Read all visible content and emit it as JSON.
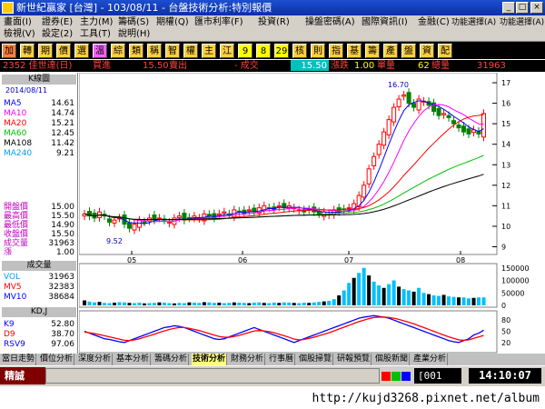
{
  "window": {
    "title": "新世紀贏家 [台灣] - 103/08/11 - 台盤技術分析:特別報價"
  },
  "menu": {
    "row1": [
      "畫面(I)",
      "證券(E)",
      "主力(M)",
      "籌碼(S)",
      "期權(Q)",
      "匯市利率(F)",
      "投資(R)",
      "操盤密碼(A)",
      "國際資訊(I)",
      "金融(C)",
      "功能選擇(A)",
      "功能選擇(A)"
    ],
    "row2": [
      "檢視(V)",
      "設定(2)",
      "工具(T)",
      "說明(H)"
    ]
  },
  "toolbar": {
    "buttons": [
      "加",
      "轉",
      "期",
      "價",
      "選",
      "溫",
      "綜",
      "類",
      "稱",
      "智",
      "權",
      "主",
      "江",
      "9",
      "8",
      "29",
      "核",
      "則",
      "指",
      "基",
      "籌",
      "產",
      "盤",
      "資",
      "配"
    ],
    "colors": [
      "#ff8040",
      "#ffd040",
      "#ffd040",
      "#ffd040",
      "#ffd040",
      "#ff60ff",
      "#ffd040",
      "#ffd040",
      "#ffd040",
      "#ffd040",
      "#ffd040",
      "#ffd040",
      "#ffd040",
      "#ffff00",
      "#ffff00",
      "#ffff00",
      "#ffd040",
      "#ffd040",
      "#ffd040",
      "#ffd040",
      "#ffd040",
      "#ffd040",
      "#ffd040",
      "#ffd040",
      "#ffd040"
    ]
  },
  "quote": {
    "code": "2352 佳世達(日)",
    "buy_label": "買進",
    "buy_value": "15.50",
    "sell_label": "賣出",
    "change_label": "- 成交",
    "last": "15.50",
    "updown_label": "漲跌",
    "updown_value": "1.00",
    "volume_label": "單量",
    "volume_value": "62",
    "total_label": "總量",
    "total_value": "31963"
  },
  "left": {
    "header": "K線圖",
    "date": "2014/08/11",
    "ma": [
      {
        "label": "MA5",
        "value": "14.61",
        "color": "#0000ff"
      },
      {
        "label": "MA10",
        "value": "14.74",
        "color": "#ff00ff"
      },
      {
        "label": "MA20",
        "value": "15.21",
        "color": "#ff0000"
      },
      {
        "label": "MA60",
        "value": "12.45",
        "color": "#00c000"
      },
      {
        "label": "MA108",
        "value": "11.42",
        "color": "#000000"
      },
      {
        "label": "MA240",
        "value": "9.21",
        "color": "#00a0ff"
      }
    ],
    "prices": [
      {
        "label": "開盤價",
        "value": "15.00"
      },
      {
        "label": "最高價",
        "value": "15.50"
      },
      {
        "label": "最低價",
        "value": "14.90"
      },
      {
        "label": "收盤價",
        "value": "15.50"
      },
      {
        "label": "成交量",
        "value": "31963"
      },
      {
        "label": "漲",
        "value": "1.00"
      }
    ],
    "vol_header": "成交量",
    "vol": [
      {
        "label": "VOL",
        "value": "31963",
        "color": "#00a0ff"
      },
      {
        "label": "MV5",
        "value": "32383",
        "color": "#ff0000"
      },
      {
        "label": "MV10",
        "value": "38684",
        "color": "#0000ff"
      }
    ],
    "kd_header": "KD,J",
    "kd": [
      {
        "label": "K9",
        "value": "52.80",
        "color": "#0000ff"
      },
      {
        "label": "D9",
        "value": "38.70",
        "color": "#ff0000"
      },
      {
        "label": "RSV9",
        "value": "97.06",
        "color": "#0000ff"
      }
    ]
  },
  "chart_data": [
    {
      "type": "candlestick",
      "title": "K線圖",
      "x_ticks": [
        "05",
        "06",
        "07",
        "08"
      ],
      "y_ticks": [
        9,
        10,
        11,
        12,
        13,
        14,
        15,
        16,
        17
      ],
      "ylim": [
        8.8,
        17.4
      ],
      "annotations": [
        {
          "label": "16.70",
          "x": "07",
          "y": 16.7
        },
        {
          "label": "9.52",
          "x": "05",
          "y": 9.52
        }
      ],
      "close": [
        10.6,
        10.5,
        10.4,
        10.7,
        10.5,
        10.2,
        10.3,
        10.4,
        10.1,
        9.9,
        10.1,
        10.3,
        10.2,
        10.4,
        10.3,
        10.4,
        10.3,
        10.2,
        10.4,
        10.5,
        10.3,
        10.4,
        10.5,
        10.4,
        10.6,
        10.5,
        10.4,
        10.6,
        10.7,
        10.6,
        10.8,
        10.7,
        10.6,
        10.8,
        10.7,
        10.9,
        11.0,
        10.9,
        10.8,
        11.0,
        10.9,
        11.0,
        10.9,
        10.8,
        10.7,
        10.8,
        10.7,
        10.6,
        10.7,
        10.6,
        10.8,
        10.7,
        10.8,
        10.9,
        11.1,
        11.5,
        12.0,
        12.8,
        13.4,
        14.0,
        14.6,
        15.2,
        15.8,
        16.2,
        16.4,
        16.0,
        15.8,
        16.2,
        16.1,
        15.9,
        15.6,
        15.4,
        15.5,
        15.3,
        15.0,
        14.8,
        14.6,
        14.5,
        14.7,
        14.5,
        15.5
      ],
      "series": [
        {
          "name": "MA5",
          "color": "#0000ff"
        },
        {
          "name": "MA10",
          "color": "#ff00ff"
        },
        {
          "name": "MA20",
          "color": "#ff0000"
        },
        {
          "name": "MA60",
          "color": "#00c000"
        },
        {
          "name": "MA108",
          "color": "#000000"
        },
        {
          "name": "MA240",
          "color": "#00a0ff"
        }
      ]
    },
    {
      "type": "bar",
      "title": "成交量",
      "y_ticks": [
        "150000",
        "100000",
        "50000",
        "0"
      ],
      "ylim": [
        0,
        160000
      ],
      "values": [
        20000,
        15000,
        12000,
        14000,
        10000,
        9000,
        11000,
        13000,
        12000,
        10000,
        9000,
        11000,
        8000,
        9000,
        10000,
        12000,
        11000,
        9000,
        8000,
        10000,
        9000,
        12000,
        11000,
        10000,
        13000,
        12000,
        10000,
        11000,
        9000,
        10000,
        12000,
        11000,
        10000,
        9000,
        11000,
        12000,
        10000,
        9000,
        11000,
        10000,
        12000,
        11000,
        10000,
        9000,
        11000,
        10000,
        12000,
        14000,
        16000,
        18000,
        25000,
        40000,
        60000,
        90000,
        110000,
        130000,
        150000,
        120000,
        95000,
        80000,
        70000,
        85000,
        100000,
        75000,
        65000,
        60000,
        55000,
        70000,
        50000,
        45000,
        40000,
        38000,
        42000,
        36000,
        34000,
        32000,
        31963,
        28000,
        30000,
        32000,
        31963
      ]
    },
    {
      "type": "line",
      "title": "KD,J",
      "y_ticks": [
        80,
        50,
        20
      ],
      "ylim": [
        0,
        100
      ],
      "series": [
        {
          "name": "K9",
          "color": "#0000ff",
          "values": [
            50,
            45,
            40,
            35,
            30,
            28,
            25,
            22,
            20,
            25,
            30,
            35,
            40,
            45,
            50,
            55,
            60,
            62,
            65,
            63,
            60,
            55,
            50,
            45,
            40,
            35,
            30,
            28,
            30,
            35,
            40,
            45,
            50,
            55,
            60,
            55,
            50,
            45,
            40,
            35,
            30,
            25,
            20,
            25,
            30,
            35,
            40,
            45,
            50,
            55,
            60,
            65,
            70,
            75,
            80,
            85,
            88,
            90,
            92,
            90,
            88,
            85,
            80,
            75,
            70,
            65,
            60,
            55,
            50,
            45,
            40,
            35,
            30,
            25,
            22,
            20,
            25,
            30,
            40,
            45,
            52.8
          ]
        },
        {
          "name": "D9",
          "color": "#ff0000",
          "values": [
            48,
            46,
            44,
            41,
            38,
            35,
            32,
            29,
            26,
            25,
            27,
            30,
            34,
            38,
            42,
            47,
            51,
            55,
            58,
            60,
            60,
            58,
            55,
            52,
            48,
            44,
            40,
            36,
            34,
            34,
            36,
            39,
            43,
            47,
            51,
            52,
            51,
            49,
            46,
            42,
            38,
            34,
            29,
            27,
            28,
            31,
            34,
            38,
            42,
            46,
            51,
            56,
            61,
            66,
            71,
            76,
            80,
            84,
            87,
            88,
            88,
            87,
            85,
            82,
            78,
            74,
            70,
            65,
            60,
            55,
            50,
            45,
            40,
            35,
            31,
            27,
            26,
            27,
            31,
            35,
            38.7
          ]
        }
      ]
    }
  ],
  "tabs": [
    "當日走勢",
    "價位分析",
    "深度分析",
    "基本分析",
    "籌碼分析",
    "技術分析",
    "財務分析",
    "行事曆",
    "個股掃覽",
    "研報預覽",
    "個股新聞",
    "產業分析"
  ],
  "status": {
    "left": "精誠",
    "code": "001",
    "time": "14:10:07"
  },
  "footer": {
    "url": "http://kujd3268.pixnet.net/album"
  }
}
